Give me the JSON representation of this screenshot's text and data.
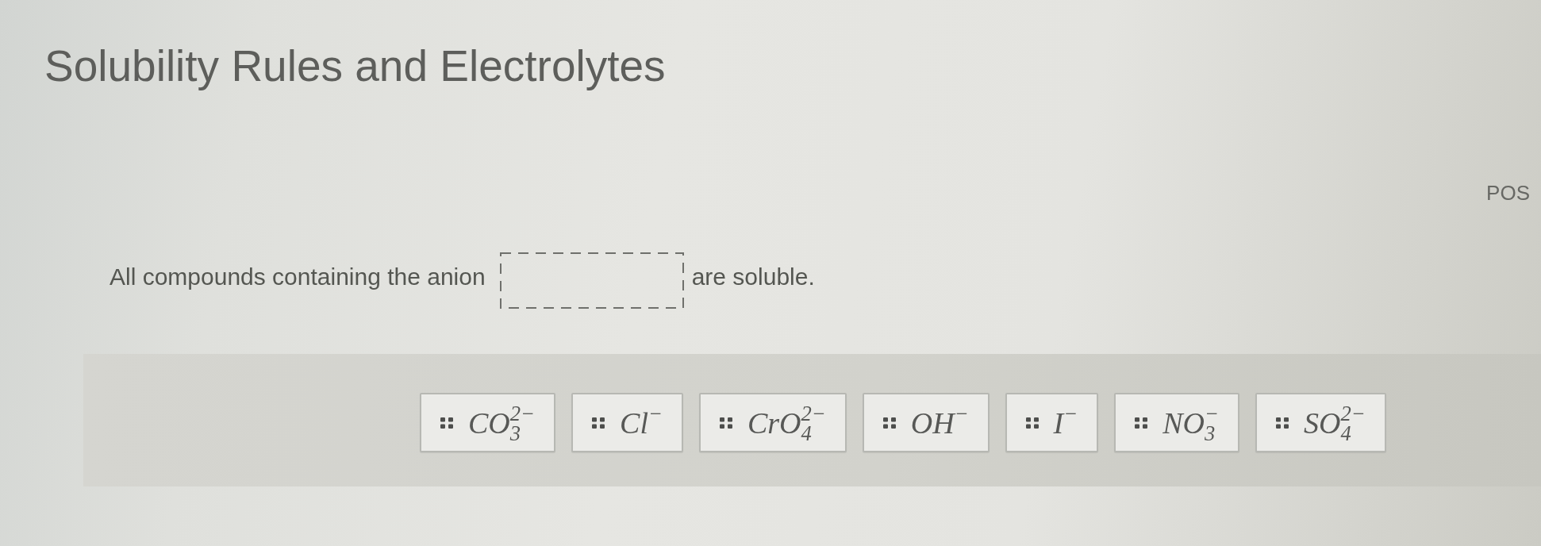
{
  "header": {
    "title": "Solubility Rules and Electrolytes",
    "side_label": "POS"
  },
  "question": {
    "text_before": "All compounds containing the anion",
    "text_after": "are soluble."
  },
  "tiles": [
    {
      "formula": "CO$_{3}$$^{2−}$"
    },
    {
      "formula": "Cl$^{−}$"
    },
    {
      "formula": "CrO$_{4}$$^{2−}$"
    },
    {
      "formula": "OH$^{−}$"
    },
    {
      "formula": "I$^{−}$"
    },
    {
      "formula": "NO$_{3}$$^{−}$"
    },
    {
      "formula": "SO$_{4}$$^{2−}$"
    }
  ]
}
